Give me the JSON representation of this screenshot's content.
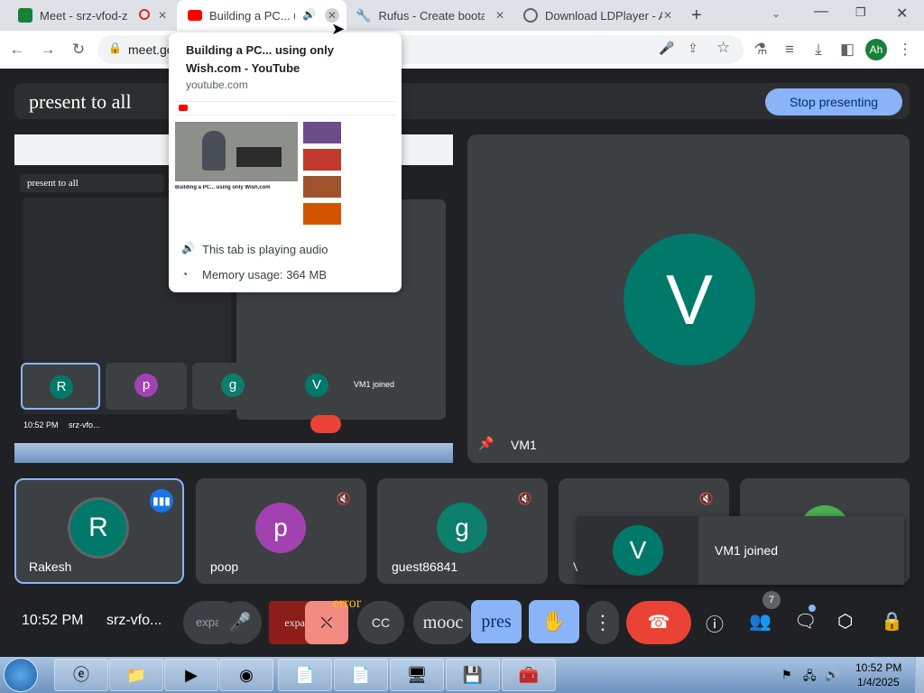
{
  "browser": {
    "tabs": [
      {
        "title": "Meet - srz-vfod-z",
        "favicon_color": "#188038"
      },
      {
        "title": "Building a PC... using",
        "favicon_color": "#ff0000"
      },
      {
        "title": "Rufus - Create bootable",
        "favicon_color": "#5f6368"
      },
      {
        "title": "Download LDPlayer - A",
        "favicon_color": "#5f6368"
      }
    ],
    "url": "meet.google.com",
    "profile_initials": "Ah"
  },
  "hover_card": {
    "title": "Building a PC... using only Wish.com - YouTube",
    "domain": "youtube.com",
    "audio_text": "This tab is playing audio",
    "memory_text": "Memory usage: 364 MB",
    "preview_title": "Building a PC... using only Wish.com"
  },
  "meet": {
    "present_title": "present to all",
    "stop_presenting_label": "Stop presenting",
    "main_participant": {
      "initial": "V",
      "name": "VM1",
      "color": "#00796b"
    },
    "participants": [
      {
        "initial": "R",
        "name": "Rakesh",
        "color": "#00796b"
      },
      {
        "initial": "p",
        "name": "poop",
        "color": "#a142b0"
      },
      {
        "initial": "g",
        "name": "guest86841",
        "color": "#0d7d6c"
      },
      {
        "initial": "V",
        "name": "V",
        "color": "#00796b"
      },
      {
        "initial": "",
        "name": "",
        "color": "#4caf50"
      }
    ],
    "toast": {
      "initial": "V",
      "text": "VM1 joined"
    },
    "bottom_bar": {
      "time": "10:52 PM",
      "meeting_code": "srz-vfo...",
      "expand_label": "expa",
      "expand_label2": "expansions",
      "error_label": "error",
      "mood_label": "mooc",
      "pres_label": "pres",
      "people_count": "7"
    }
  },
  "taskbar": {
    "time": "10:52 PM",
    "date": "1/4/2025"
  },
  "colors": {
    "meet_bg": "#202124",
    "tile_bg": "#3c4043",
    "accent_blue": "#8ab4f8",
    "end_call_red": "#ea4335"
  }
}
